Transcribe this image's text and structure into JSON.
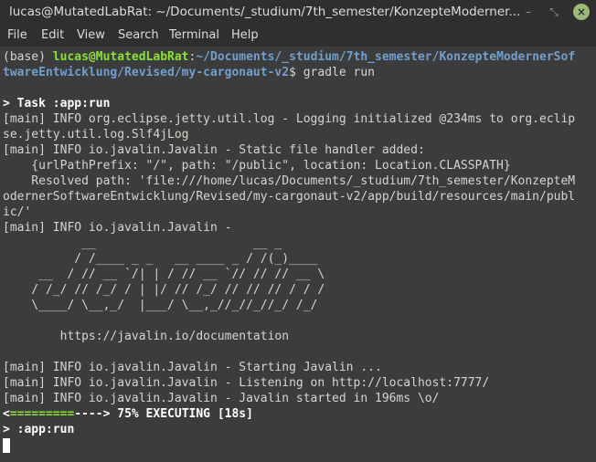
{
  "window": {
    "title": "lucas@MutatedLabRat: ~/Documents/_studium/7th_semester/KonzepteModerner...",
    "minimize_icon": "minimize-icon",
    "maximize_icon": "maximize-icon",
    "close_icon": "close-icon",
    "close_color": "#9bb97a"
  },
  "menu": [
    "File",
    "Edit",
    "View",
    "Search",
    "Terminal",
    "Help"
  ],
  "prompt": {
    "env": "(base) ",
    "user_host": "lucas@MutatedLabRat",
    "sep": ":",
    "path_line1": "~/Documents/_studium/7th_semester/KonzepteModernerSof",
    "path_line2": "twareEntwicklung/Revised/my-cargonaut-v2",
    "dollar": "$ ",
    "command": "gradle run"
  },
  "output": {
    "task": "> Task :app:run",
    "lines": [
      "[main] INFO org.eclipse.jetty.util.log - Logging initialized @234ms to org.eclip",
      "se.jetty.util.log.Slf4jLog",
      "[main] INFO io.javalin.Javalin - Static file handler added:",
      "    {urlPathPrefix: \"/\", path: \"/public\", location: Location.CLASSPATH}",
      "    Resolved path: 'file:///home/lucas/Documents/_studium/7th_semester/KonzepteM",
      "odernerSoftwareEntwicklung/Revised/my-cargonaut-v2/app/build/resources/main/publ",
      "ic/'",
      "[main] INFO io.javalin.Javalin -"
    ],
    "banner": [
      "           __                      __ _",
      "          / /____ _ _   __ ____ _ / /(_)____",
      "     __  / // __ `/| | / // __ `// // // __ \\",
      "    / /_/ // /_/ / | |/ // /_/ // // // / / /",
      "    \\____/ \\__,_/  |___/ \\__,_//_//_//_/ /_/"
    ],
    "docs_url": "        https://javalin.io/documentation",
    "log_lines": [
      "[main] INFO io.javalin.Javalin - Starting Javalin ...",
      "[main] INFO io.javalin.Javalin - Listening on http://localhost:7777/",
      "[main] INFO io.javalin.Javalin - Javalin started in 196ms \\o/"
    ],
    "progress": {
      "open": "<",
      "done": "=========",
      "remaining": "---->",
      "status": " 75% EXECUTING [18s]",
      "percent": 75
    },
    "current_task": "> :app:run"
  },
  "colors": {
    "prompt_user": "#8ae234",
    "prompt_path": "#729fcf",
    "progress_done": "#8ae234",
    "background": "#3c3c3c"
  }
}
